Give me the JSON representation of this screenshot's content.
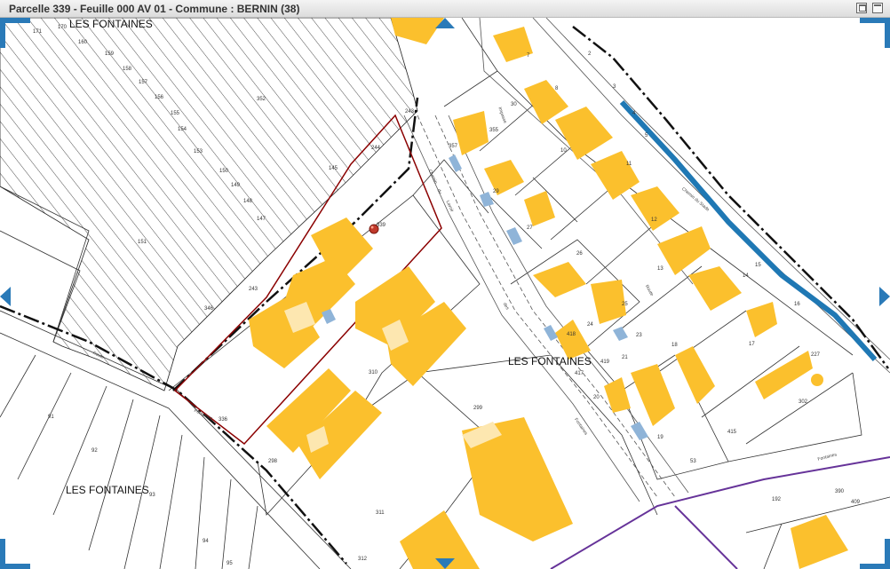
{
  "window": {
    "title": "Parcelle 339 - Feuille 000 AV 01 - Commune : BERNIN (38)"
  },
  "map": {
    "locality_labels": [
      "LES FONTAINES",
      "LES FONTAINES",
      "LES FONTAINES"
    ],
    "selected_parcel": "339",
    "parcel_numbers": [
      "171",
      "170",
      "160",
      "159",
      "158",
      "157",
      "156",
      "155",
      "154",
      "153",
      "150",
      "149",
      "148",
      "147",
      "151",
      "243",
      "346",
      "145",
      "244",
      "243",
      "352",
      "357",
      "355",
      "7",
      "2",
      "3",
      "4",
      "5",
      "8",
      "10",
      "11",
      "12",
      "13",
      "14",
      "15",
      "16",
      "17",
      "18",
      "20",
      "21",
      "23",
      "24",
      "25",
      "26",
      "27",
      "29",
      "30",
      "299",
      "310",
      "336",
      "298",
      "311",
      "312",
      "91",
      "92",
      "93",
      "94",
      "95",
      "227",
      "302",
      "415",
      "53",
      "418",
      "419",
      "417",
      "19",
      "192",
      "390",
      "409"
    ],
    "street_labels": [
      "Chemin",
      "du",
      "Lavoir",
      "Impasse",
      "Chemin du Stade",
      "Route",
      "des",
      "Fontaines",
      "Fontaines",
      "Route",
      "Fontaines"
    ],
    "colors": {
      "building": "#fbc02d",
      "parcel_boundary": "#8b0000",
      "water": "#1f78b4",
      "commune_boundary": "#663399",
      "control": "#2a7ab8"
    },
    "icons": [
      "zoom-corner-icon",
      "pan-up-arrow",
      "pan-down-arrow",
      "pan-left-arrow",
      "pan-right-arrow",
      "location-marker-icon"
    ]
  }
}
